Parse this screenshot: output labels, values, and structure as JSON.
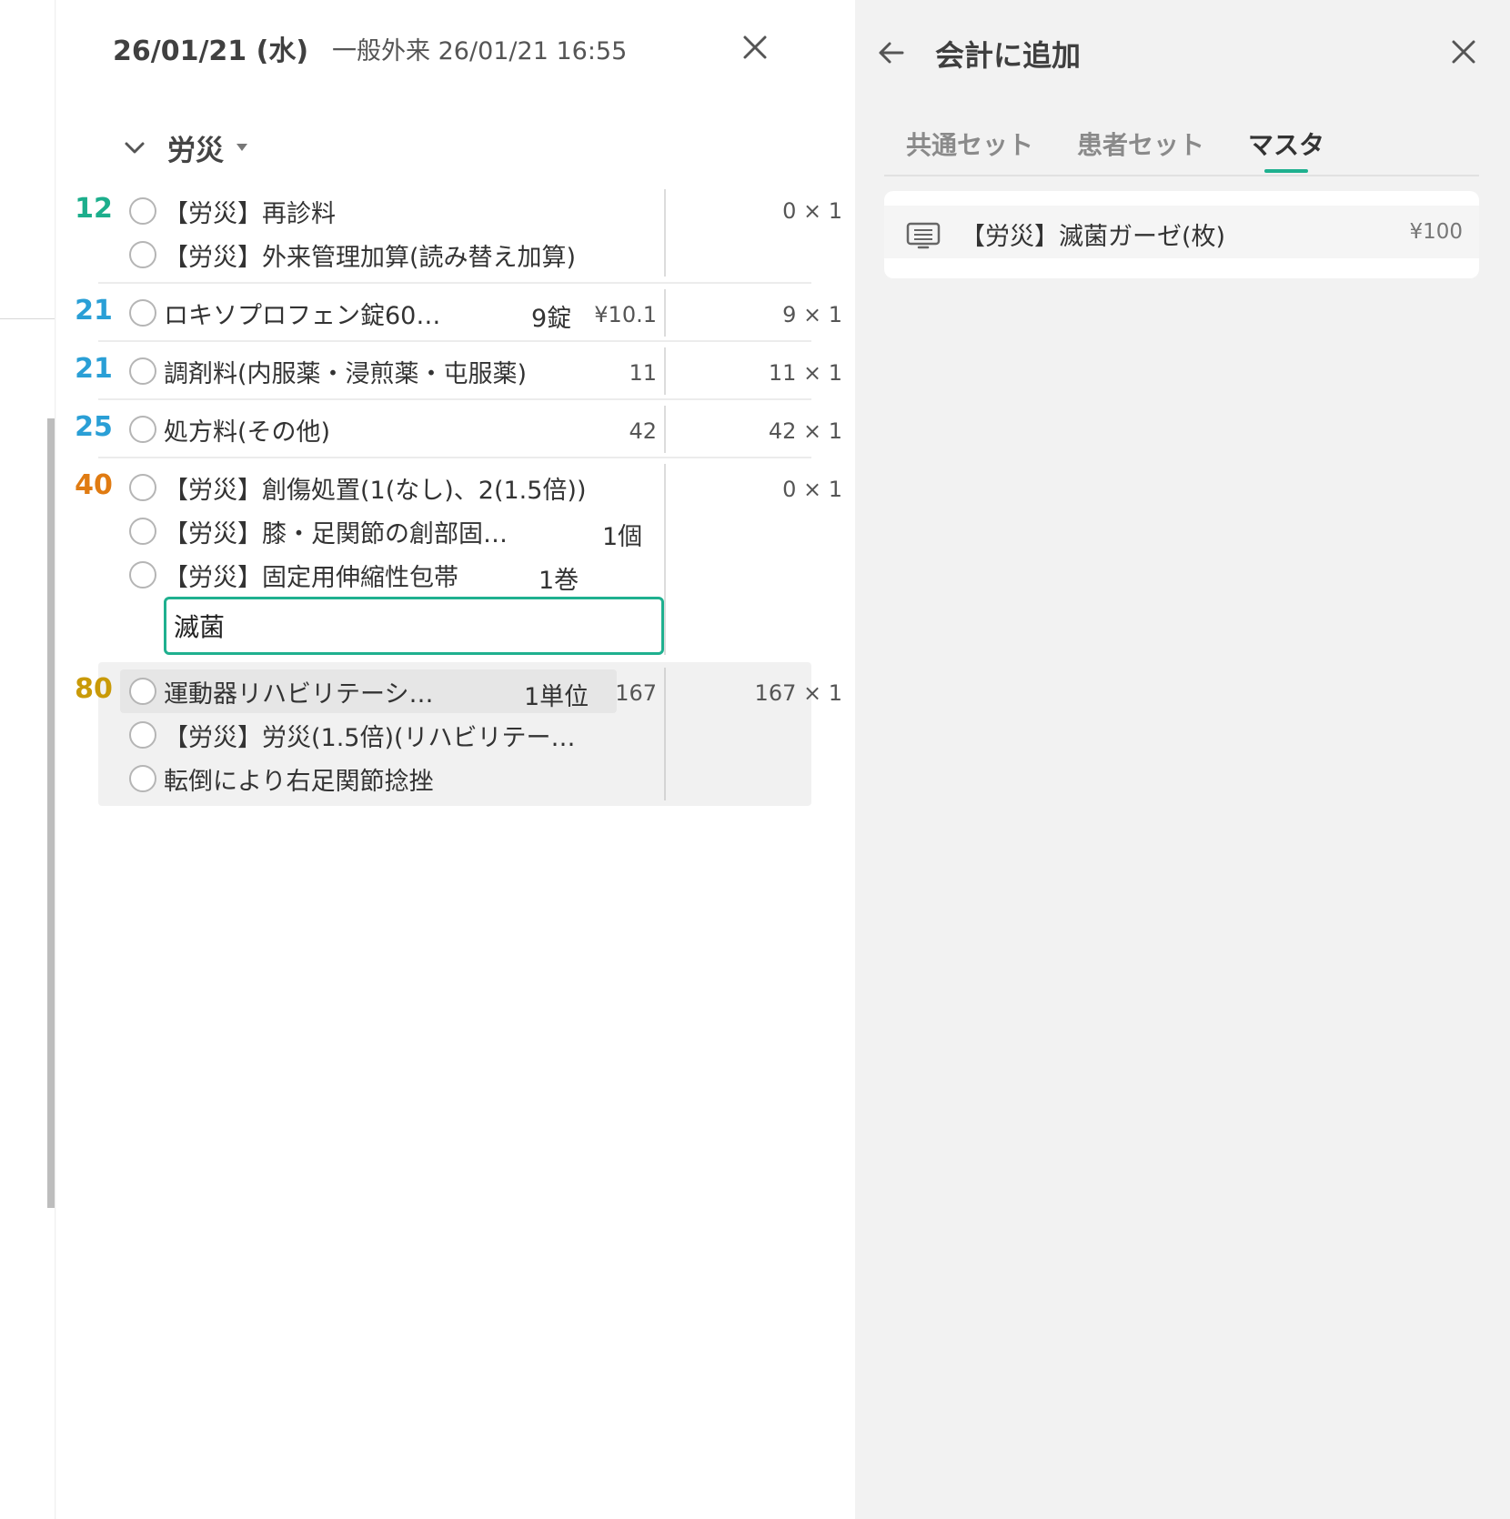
{
  "header": {
    "date": "26/01/21 (水)",
    "visit": "一般外来 26/01/21 16:55"
  },
  "group": {
    "label": "労災"
  },
  "sections": [
    {
      "code": "12",
      "color": "#1cae8c",
      "items": [
        {
          "text": "【労災】再診料",
          "qty": "",
          "price": ""
        },
        {
          "text": "【労災】外来管理加算(読み替え加算)",
          "qty": "",
          "price": ""
        }
      ],
      "mult": "0 × 1"
    },
    {
      "code": "21",
      "color": "#2a9fd6",
      "items": [
        {
          "text": "ロキソプロフェン錠60…",
          "qty": "9錠",
          "price": "¥10.1"
        }
      ],
      "mult": "9 × 1"
    },
    {
      "code": "21",
      "color": "#2a9fd6",
      "items": [
        {
          "text": "調剤料(内服薬・浸煎薬・屯服薬)",
          "qty": "",
          "price": "11"
        }
      ],
      "mult": "11 × 1"
    },
    {
      "code": "25",
      "color": "#2a9fd6",
      "items": [
        {
          "text": "処方料(その他)",
          "qty": "",
          "price": "42"
        }
      ],
      "mult": "42 × 1"
    },
    {
      "code": "40",
      "color": "#e07b12",
      "items": [
        {
          "text": "【労災】創傷処置(1(なし)、2(1.5倍))",
          "qty": "",
          "price": ""
        },
        {
          "text": "【労災】膝・足関節の創部固…",
          "qty": "1個",
          "price": ""
        },
        {
          "text": "【労災】固定用伸縮性包帯",
          "qty": "1巻",
          "price": ""
        }
      ],
      "mult": "0 × 1"
    },
    {
      "code": "80",
      "color": "#c99a08",
      "items": [
        {
          "text": "運動器リハビリテーシ…",
          "qty": "1単位",
          "price": "167"
        },
        {
          "text": "【労災】労災(1.5倍)(リハビリテー…",
          "qty": "",
          "price": ""
        },
        {
          "text": "転倒により右足関節捻挫",
          "qty": "",
          "price": ""
        }
      ],
      "mult": "167 × 1"
    }
  ],
  "search": {
    "value": "滅菌"
  },
  "right": {
    "title": "会計に追加",
    "tabs": [
      {
        "label": "共通セット"
      },
      {
        "label": "患者セット"
      },
      {
        "label": "マスタ"
      }
    ],
    "active_tab": 2,
    "result": {
      "text": "【労災】滅菌ガーゼ(枚)",
      "price": "¥100"
    }
  },
  "icons": {
    "close": "close-icon",
    "back": "arrow-left-icon",
    "chevron": "chevron-down-icon",
    "caret": "caret-down-icon",
    "master": "master-list-icon",
    "radio": "radio-icon"
  },
  "colors": {
    "accent": "#1fb08f"
  }
}
